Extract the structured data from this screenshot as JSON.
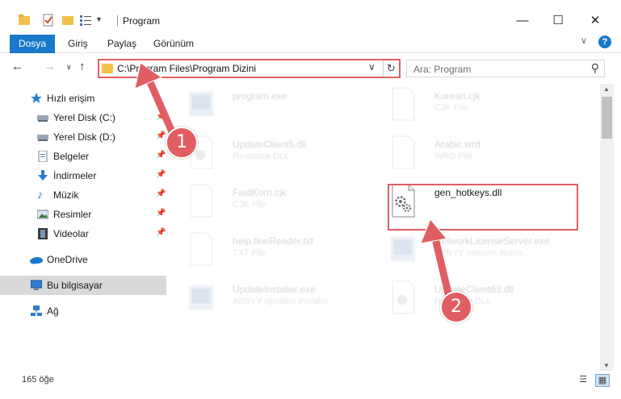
{
  "window": {
    "title": "Program",
    "minimize_glyph": "—",
    "maximize_glyph": "☐",
    "close_glyph": "✕"
  },
  "ribbon": {
    "tabs": [
      "Dosya",
      "Giriş",
      "Paylaş",
      "Görünüm"
    ]
  },
  "nav": {
    "address": "C:\\Program Files\\Program Dizini",
    "search_placeholder": "Ara: Program"
  },
  "sidebar": {
    "items": [
      {
        "label": "Hızlı erişim",
        "icon": "star-icon",
        "pinned": false
      },
      {
        "label": "Yerel Disk (C:)",
        "icon": "drive-icon",
        "pinned": true
      },
      {
        "label": "Yerel Disk (D:)",
        "icon": "drive-icon",
        "pinned": true
      },
      {
        "label": "Belgeler",
        "icon": "documents-icon",
        "pinned": true
      },
      {
        "label": "İndirmeler",
        "icon": "download-icon",
        "pinned": true
      },
      {
        "label": "Müzik",
        "icon": "music-icon",
        "pinned": true
      },
      {
        "label": "Resimler",
        "icon": "pictures-icon",
        "pinned": true
      },
      {
        "label": "Videolar",
        "icon": "videos-icon",
        "pinned": true
      },
      {
        "label": "OneDrive",
        "icon": "cloud-icon",
        "pinned": false
      },
      {
        "label": "Bu bilgisayar",
        "icon": "computer-icon",
        "pinned": false,
        "selected": true
      },
      {
        "label": "Ağ",
        "icon": "network-icon",
        "pinned": false
      }
    ]
  },
  "files": [
    {
      "name": "program.exe",
      "type": "",
      "icon": "exe-icon",
      "faded": true
    },
    {
      "name": "Korean.cjk",
      "type": "CJK File",
      "icon": "blank-file-icon",
      "faded": true
    },
    {
      "name": "UpdateClient5.dll",
      "type": "Resource DLL",
      "icon": "dll-icon",
      "faded": true
    },
    {
      "name": "Arabic.wrd",
      "type": "WRD File",
      "icon": "blank-file-icon",
      "faded": true
    },
    {
      "name": "FastKorn.cjk",
      "type": "CJK File",
      "icon": "blank-file-icon",
      "faded": true
    },
    {
      "name": "gen_hotkeys.dll",
      "type": "",
      "icon": "dll-gear-icon",
      "faded": false
    },
    {
      "name": "help.fineReader.txt",
      "type": "TXT File",
      "icon": "blank-file-icon",
      "faded": true
    },
    {
      "name": "NetworkLicenseServer.exe",
      "type": "ABBYY network licens...",
      "icon": "exe-icon",
      "faded": true
    },
    {
      "name": "UpdateInstaller.exe",
      "type": "ABBYY updates installer",
      "icon": "exe-icon",
      "faded": true
    },
    {
      "name": "UpdateClient63.dll",
      "type": "Resource DLL",
      "icon": "dll-icon",
      "faded": true
    }
  ],
  "status": {
    "item_count": "165 öğe"
  },
  "annotations": {
    "step1": "1",
    "step2": "2",
    "color": "#e05e63"
  }
}
